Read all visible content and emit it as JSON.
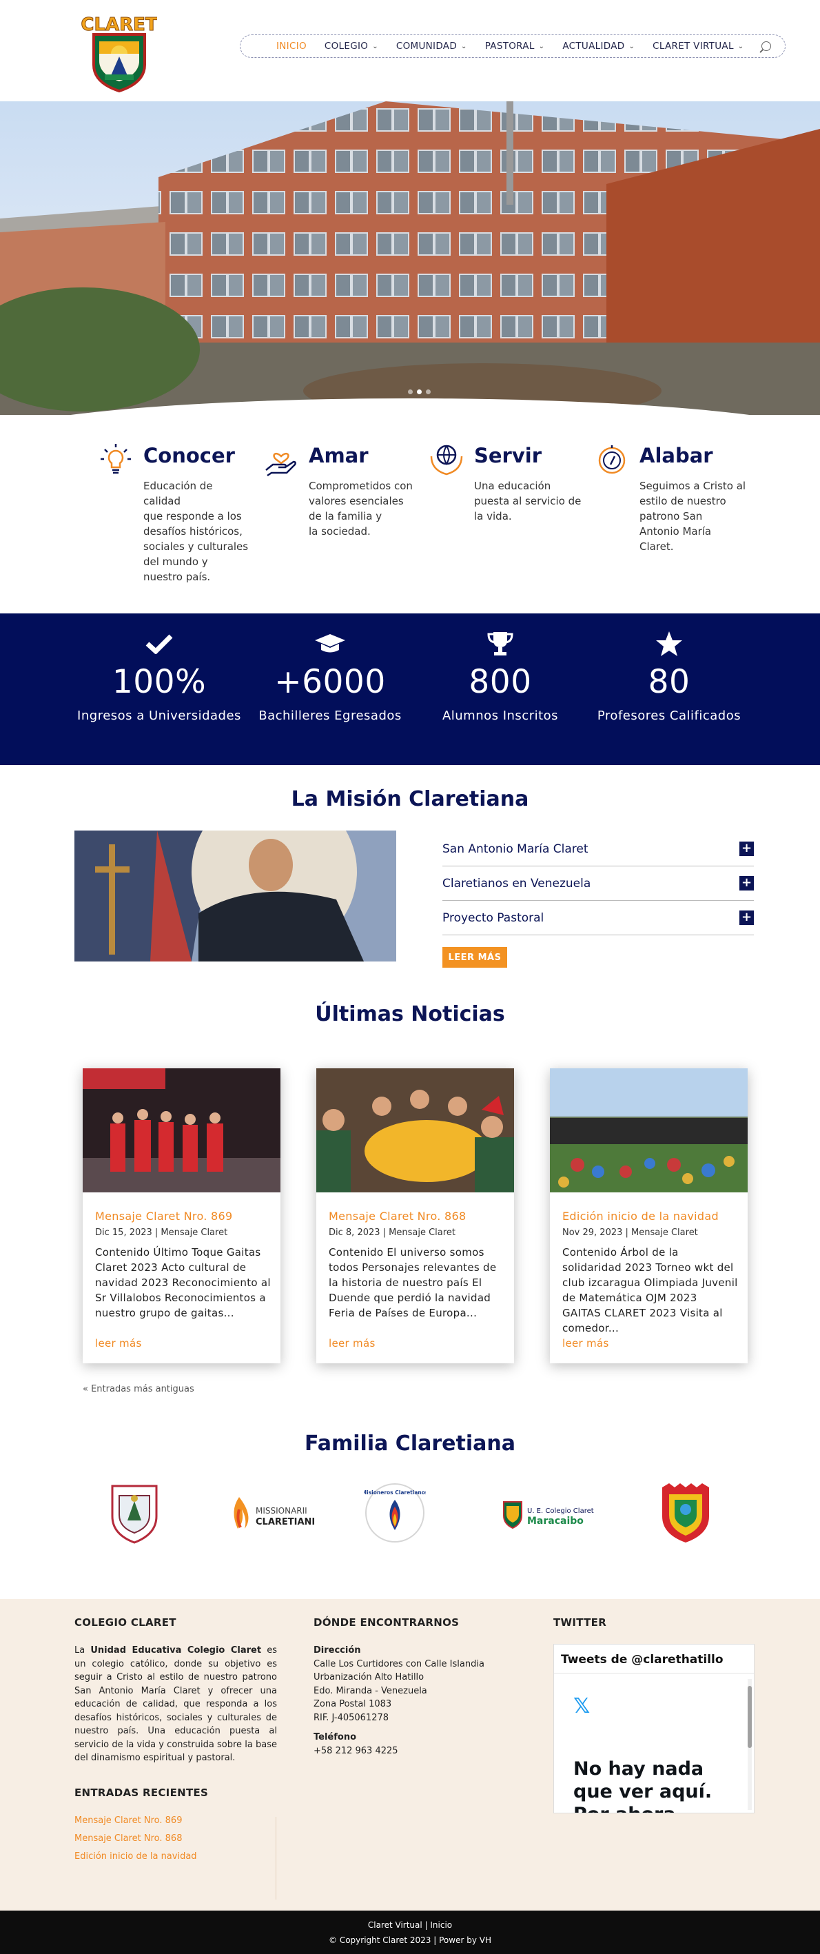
{
  "header": {
    "logo_text": "CLARET",
    "logo_banner": "Colegio Claret",
    "nav": [
      {
        "label": "INICIO",
        "active": true,
        "dropdown": false
      },
      {
        "label": "COLEGIO",
        "active": false,
        "dropdown": true
      },
      {
        "label": "COMUNIDAD",
        "active": false,
        "dropdown": true
      },
      {
        "label": "PASTORAL",
        "active": false,
        "dropdown": true
      },
      {
        "label": "ACTUALIDAD",
        "active": false,
        "dropdown": true
      },
      {
        "label": "CLARET VIRTUAL",
        "active": false,
        "dropdown": true
      }
    ],
    "search_icon": "search-icon"
  },
  "hero": {
    "slides": 3,
    "active_slide": 2
  },
  "features": [
    {
      "icon": "lightbulb-icon",
      "title": "Conocer",
      "lines": [
        "Educación de",
        "calidad",
        "que responde a los",
        "desafíos históricos,",
        "sociales y culturales",
        "del mundo y",
        "nuestro país."
      ]
    },
    {
      "icon": "heart-hand-icon",
      "title": "Amar",
      "lines": [
        "Comprometidos con",
        "valores esenciales",
        "de la familia y",
        "la sociedad."
      ]
    },
    {
      "icon": "globe-hands-icon",
      "title": "Servir",
      "lines": [
        "Una educación",
        "puesta al servicio de",
        "la vida."
      ]
    },
    {
      "icon": "compass-icon",
      "title": "Alabar",
      "lines": [
        "Seguimos a Cristo al",
        "estilo de nuestro",
        "patrono San",
        "Antonio María",
        "Claret."
      ]
    }
  ],
  "stats": [
    {
      "icon": "check-icon",
      "value": "100%",
      "label": "Ingresos a Universidades"
    },
    {
      "icon": "graduation-cap-icon",
      "value": "+6000",
      "label": "Bachilleres Egresados"
    },
    {
      "icon": "trophy-icon",
      "value": "800",
      "label": "Alumnos Inscritos"
    },
    {
      "icon": "star-icon",
      "value": "80",
      "label": "Profesores Calificados"
    }
  ],
  "mission": {
    "title": "La Misión Claretiana",
    "accordion": [
      "San Antonio María Claret",
      "Claretianos en Venezuela",
      "Proyecto Pastoral"
    ],
    "button": "LEER MÁS"
  },
  "news": {
    "title": "Últimas Noticias",
    "posts": [
      {
        "title": "Mensaje Claret Nro. 869",
        "meta": "Dic 15, 2023 | Mensaje Claret",
        "excerpt": "Contenido Último Toque Gaitas Claret 2023 Acto cultural de navidad 2023 Reconocimiento al Sr Villalobos Reconocimientos a nuestro grupo de gaitas...",
        "more": "leer más"
      },
      {
        "title": "Mensaje Claret Nro. 868",
        "meta": "Dic 8, 2023 | Mensaje Claret",
        "excerpt": "Contenido El universo somos todos Personajes relevantes de la historia de nuestro país El Duende que perdió la navidad Feria de Países de Europa...",
        "more": "leer más"
      },
      {
        "title": "Edición inicio de la navidad",
        "meta": "Nov 29, 2023 | Mensaje Claret",
        "excerpt": "Contenido Árbol de la solidaridad 2023 Torneo wkt del club izcaragua Olimpiada Juvenil de Matemática OJM 2023 GAITAS CLARET 2023 Visita al comedor...",
        "more": "leer más"
      }
    ],
    "older": "« Entradas más antiguas"
  },
  "family": {
    "title": "Familia Claretiana",
    "logos": [
      {
        "name": "crest-logo-1",
        "text": ""
      },
      {
        "name": "missionarii-logo",
        "text_top": "MISSIONARII",
        "text_bottom": "CLARETIANI"
      },
      {
        "name": "misioneros-claretianos-logo",
        "text": "Misioneros Claretianos"
      },
      {
        "name": "claret-maracaibo-logo",
        "text_top": "U. E. Colegio Claret",
        "text_bottom": "Maracaibo"
      },
      {
        "name": "crest-logo-2",
        "text": ""
      }
    ]
  },
  "footer": {
    "col1_head": "COLEGIO CLARET",
    "about_prefix": "La ",
    "about_bold": "Unidad Educativa Colegio Claret",
    "about_rest": " es un colegio católico, donde su objetivo es seguir a Cristo al estilo de nuestro patrono San Antonio María Claret y ofrecer una educación de calidad, que responda a los desafíos históricos, sociales y culturales de nuestro país. Una educación puesta al servicio de la vida y construida sobre la base del dinamismo espiritual y pastoral.",
    "col2_head": "DÓNDE ENCONTRARNOS",
    "dir_label": "Dirección",
    "dir_lines": [
      "Calle Los Curtidores con Calle Islandia",
      "Urbanización Alto Hatillo",
      "Edo. Miranda - Venezuela",
      "Zona Postal 1083",
      "RIF. J-405061278"
    ],
    "tel_label": "Teléfono",
    "tel": "+58 212 963 4225",
    "col3_head": "TWITTER",
    "twitter_head": "Tweets de @clarethatillo",
    "twitter_empty": "No hay nada que ver aquí. Por ahora.",
    "recent_head": "ENTRADAS RECIENTES",
    "recent": [
      "Mensaje Claret Nro. 869",
      "Mensaje Claret Nro. 868",
      "Edición inicio de la navidad"
    ]
  },
  "bottom": {
    "links": "Claret Virtual | Inicio",
    "copyright": "© Copyright Claret 2023 | Power by VH"
  }
}
